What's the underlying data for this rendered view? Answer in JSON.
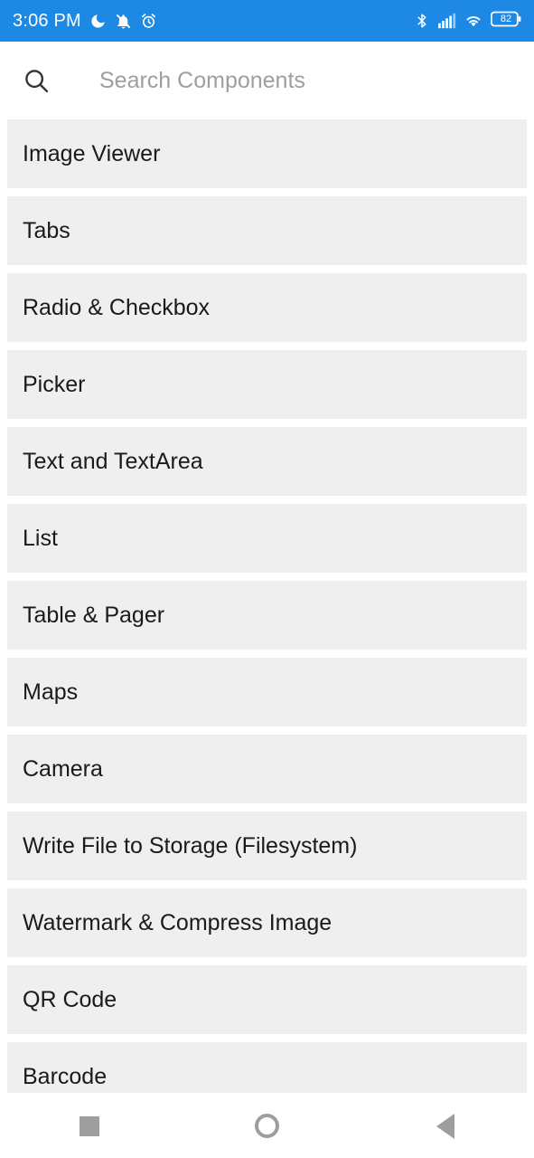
{
  "status_bar": {
    "clock": "3:06 PM",
    "battery_level": "82",
    "icons": [
      "moon-icon",
      "notification-off-icon",
      "alarm-icon",
      "bluetooth-icon",
      "cellular-signal-icon",
      "wifi-icon",
      "battery-icon"
    ],
    "background_color": "#1E88E5"
  },
  "search": {
    "placeholder": "Search Components",
    "value": "",
    "icon": "search-icon"
  },
  "list": {
    "items": [
      {
        "label": "Image Viewer"
      },
      {
        "label": "Tabs"
      },
      {
        "label": "Radio & Checkbox"
      },
      {
        "label": "Picker"
      },
      {
        "label": "Text and TextArea"
      },
      {
        "label": "List"
      },
      {
        "label": "Table & Pager"
      },
      {
        "label": "Maps"
      },
      {
        "label": "Camera"
      },
      {
        "label": "Write File to Storage (Filesystem)"
      },
      {
        "label": "Watermark & Compress Image"
      },
      {
        "label": "QR Code"
      },
      {
        "label": "Barcode"
      }
    ]
  },
  "nav_bar": {
    "buttons": [
      {
        "name": "recent-apps-button"
      },
      {
        "name": "home-button"
      },
      {
        "name": "back-button"
      }
    ]
  }
}
